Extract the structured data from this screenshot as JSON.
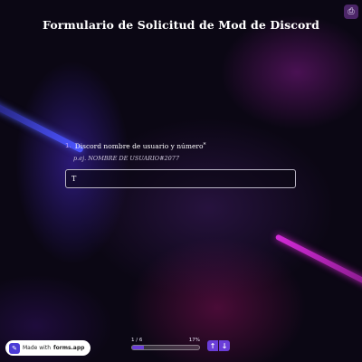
{
  "form": {
    "title": "Formulario de Solicitud de Mod de Discord"
  },
  "question": {
    "number": "1.",
    "label": "Discord nombre de usuario y número",
    "required_mark": "*",
    "hint": "p.ej. NOMBRE DE USUARIO#2077",
    "value": "T"
  },
  "footer": {
    "badge_prefix": "Made with",
    "badge_brand": "forms.app",
    "progress_label": "1 / 6",
    "progress_percent_label": "17%",
    "progress_fraction": 0.17
  },
  "icons": {
    "corner": "printer-icon",
    "logo": "forms-app-logo-icon",
    "up": "arrow-up-icon",
    "down": "arrow-down-icon"
  },
  "colors": {
    "accent": "#6a3dd8",
    "background": "#0b0714"
  }
}
